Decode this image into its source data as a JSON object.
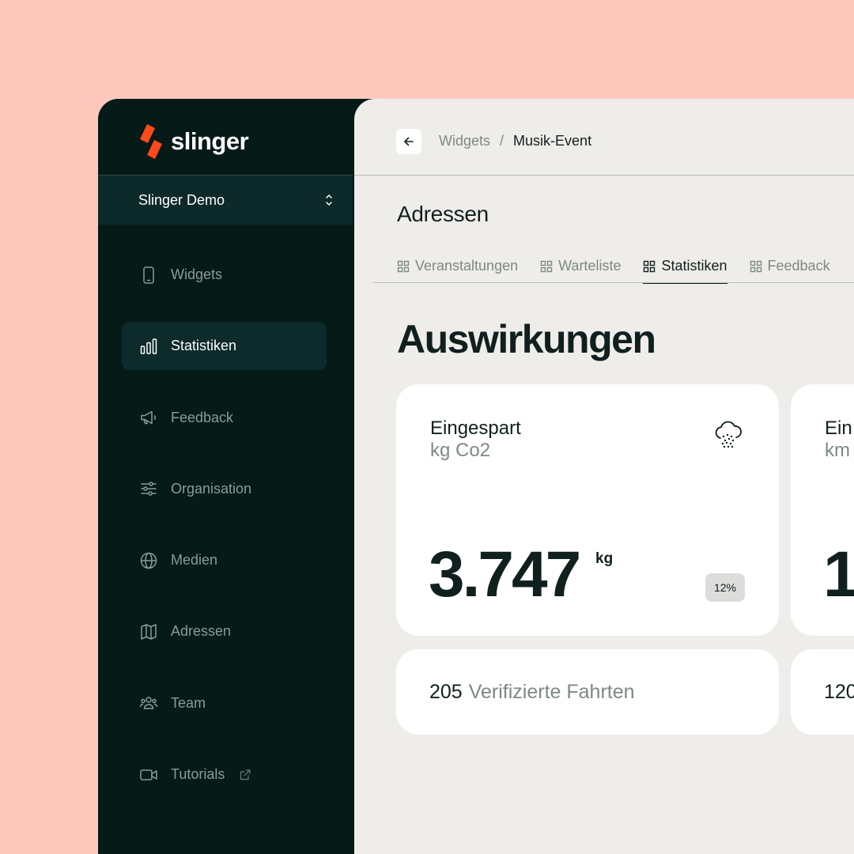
{
  "brand": {
    "name": "slinger",
    "accent_color": "#ff4a1c"
  },
  "organization": {
    "name": "Slinger Demo"
  },
  "sidebar": {
    "items": [
      {
        "label": "Widgets",
        "icon": "phone-icon"
      },
      {
        "label": "Statistiken",
        "icon": "bar-chart-icon",
        "active": true
      },
      {
        "label": "Feedback",
        "icon": "megaphone-icon"
      },
      {
        "label": "Organisation",
        "icon": "sliders-icon"
      },
      {
        "label": "Medien",
        "icon": "globe-icon"
      },
      {
        "label": "Adressen",
        "icon": "map-icon"
      },
      {
        "label": "Team",
        "icon": "users-icon"
      },
      {
        "label": "Tutorials",
        "icon": "video-icon",
        "external": true
      }
    ]
  },
  "breadcrumb": {
    "parent": "Widgets",
    "separator": "/",
    "current": "Musik-Event"
  },
  "section": {
    "title": "Adressen"
  },
  "tabs": [
    {
      "label": "Veranstaltungen",
      "icon": "grid-icon"
    },
    {
      "label": "Warteliste",
      "icon": "grid-icon"
    },
    {
      "label": "Statistiken",
      "icon": "grid-icon",
      "active": true
    },
    {
      "label": "Feedback",
      "icon": "grid-icon"
    }
  ],
  "page": {
    "title": "Auswirkungen"
  },
  "cards": [
    {
      "title": "Eingespart",
      "subtitle": "kg Co2",
      "value": "3.747",
      "unit": "kg",
      "badge": "12%",
      "icon": "cloud-rain-icon"
    },
    {
      "title": "Ein",
      "subtitle": "km",
      "value": "1"
    }
  ],
  "stats": [
    {
      "value": "205",
      "label": "Verifizierte Fahrten"
    },
    {
      "value": "120",
      "label": ""
    }
  ],
  "colors": {
    "background": "#ffc8bd",
    "sidebar": "#061a18",
    "main": "#efede9",
    "text_dark": "#10201e",
    "text_muted": "#7c8986"
  }
}
